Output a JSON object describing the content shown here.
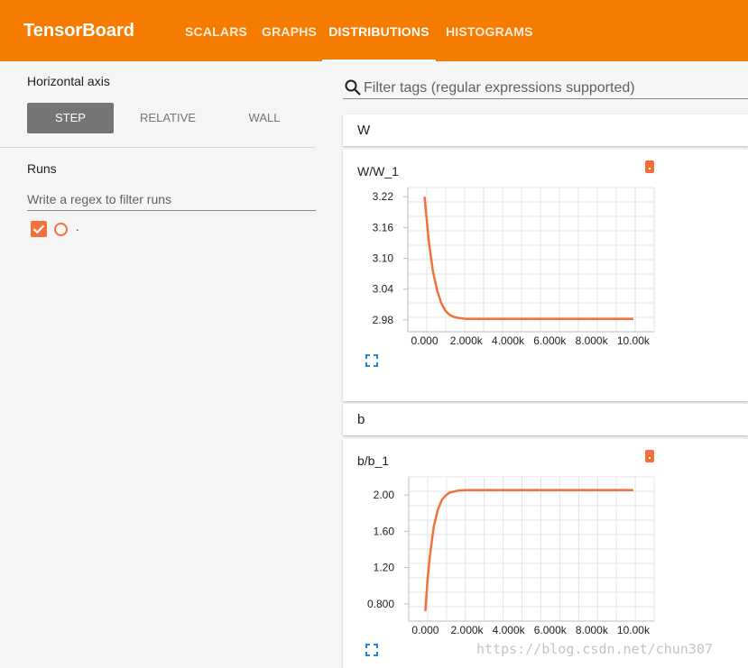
{
  "header": {
    "brand": "TensorBoard",
    "tabs": [
      {
        "label": "SCALARS",
        "active": false
      },
      {
        "label": "GRAPHS",
        "active": false
      },
      {
        "label": "DISTRIBUTIONS",
        "active": true
      },
      {
        "label": "HISTOGRAMS",
        "active": false
      }
    ],
    "color": "#f57c00"
  },
  "sidebar": {
    "horizontal_axis_label": "Horizontal axis",
    "axis_options": [
      {
        "label": "STEP",
        "active": true
      },
      {
        "label": "RELATIVE",
        "active": false
      },
      {
        "label": "WALL",
        "active": false
      }
    ],
    "runs_label": "Runs",
    "run_filter_placeholder": "Write a regex to filter runs",
    "runs": [
      {
        "name": ".",
        "checked": true,
        "color": "#f4703a"
      }
    ]
  },
  "main": {
    "tag_filter_placeholder": "Filter tags (regular expressions supported)",
    "search_icon": "search-icon",
    "categories": [
      {
        "name": "W",
        "card_title": "W/W_1"
      },
      {
        "name": "b",
        "card_title": "b/b_1"
      }
    ]
  },
  "chart_data": [
    {
      "type": "line",
      "title": "W/W_1",
      "xlabel": "",
      "ylabel": "",
      "x": [
        0,
        200,
        400,
        600,
        800,
        1000,
        1200,
        1400,
        1600,
        2000,
        3000,
        4000,
        6000,
        8000,
        10000
      ],
      "series": [
        {
          "values": [
            3.22,
            3.135,
            3.075,
            3.038,
            3.013,
            2.998,
            2.99,
            2.986,
            2.984,
            2.982,
            2.982,
            2.982,
            2.982,
            2.982,
            2.982
          ],
          "color": "#f4703a"
        }
      ],
      "xticks": [
        "0.000",
        "2.000k",
        "4.000k",
        "6.000k",
        "8.000k",
        "10.00k"
      ],
      "yticks": [
        "2.98",
        "3.04",
        "3.10",
        "3.16",
        "3.22"
      ],
      "xlim": [
        -800,
        11000
      ],
      "ylim": [
        2.957,
        3.238
      ],
      "grid": true
    },
    {
      "type": "line",
      "title": "b/b_1",
      "xlabel": "",
      "ylabel": "",
      "x": [
        0,
        100,
        200,
        400,
        600,
        800,
        1000,
        1200,
        1600,
        2000,
        3000,
        4000,
        6000,
        8000,
        10000
      ],
      "series": [
        {
          "values": [
            0.72,
            1.05,
            1.3,
            1.65,
            1.84,
            1.95,
            2.0,
            2.03,
            2.05,
            2.055,
            2.055,
            2.055,
            2.055,
            2.055,
            2.055
          ],
          "color": "#f4703a"
        }
      ],
      "xticks": [
        "0.000",
        "2.000k",
        "4.000k",
        "6.000k",
        "8.000k",
        "10.00k"
      ],
      "yticks": [
        "0.800",
        "1.20",
        "1.60",
        "2.00"
      ],
      "xlim": [
        -800,
        11000
      ],
      "ylim": [
        0.61,
        2.2
      ],
      "grid": true
    }
  ],
  "watermark": "https://blog.csdn.net/chun307"
}
